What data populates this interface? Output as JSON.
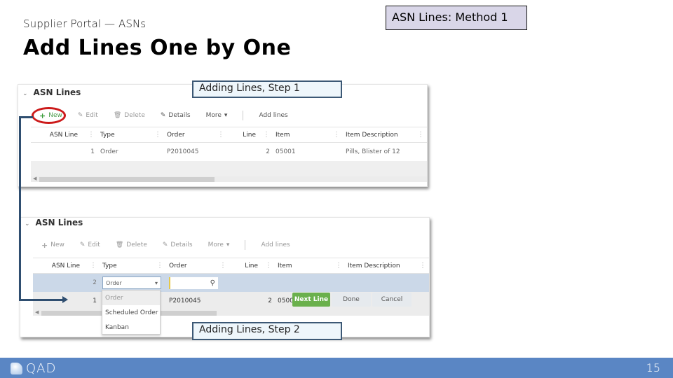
{
  "header": {
    "subtitle": "Supplier Portal — ASNs",
    "title": "Add Lines One by One",
    "method_label": "ASN Lines: Method 1"
  },
  "callouts": {
    "step1": "Adding Lines, Step 1",
    "step2": "Adding Lines, Step 2"
  },
  "panel1": {
    "heading": "ASN Lines",
    "toolbar": {
      "new": "New",
      "edit": "Edit",
      "delete": "Delete",
      "details": "Details",
      "more": "More",
      "add_lines": "Add lines"
    },
    "columns": [
      "ASN Line",
      "Type",
      "Order",
      "Line",
      "Item",
      "Item Description"
    ],
    "rows": [
      {
        "asn_line": "1",
        "type": "Order",
        "order": "P2010045",
        "line": "2",
        "item": "05001",
        "description": "Pills, Blister of 12"
      }
    ]
  },
  "panel2": {
    "heading": "ASN Lines",
    "toolbar": {
      "new": "New",
      "edit": "Edit",
      "delete": "Delete",
      "details": "Details",
      "more": "More",
      "add_lines": "Add lines"
    },
    "columns": [
      "ASN Line",
      "Type",
      "Order",
      "Line",
      "Item",
      "Item Description"
    ],
    "edit_row": {
      "asn_line": "2",
      "type_value": "Order",
      "order_value": ""
    },
    "type_options": [
      "Order",
      "Scheduled Order",
      "Kanban"
    ],
    "rows": [
      {
        "asn_line": "1",
        "order": "P2010045",
        "line": "2",
        "item": "05001"
      }
    ],
    "actions": {
      "next_line": "Next Line",
      "done": "Done",
      "cancel": "Cancel"
    }
  },
  "footer": {
    "logo_text": "QAD",
    "page_number": "15"
  },
  "colors": {
    "footer_bg": "#5a86c4",
    "method_box_bg": "#d9d6e8",
    "highlight_oval": "#cc1a1a",
    "connector": "#2f4e70",
    "next_line_button": "#6ab04c",
    "edit_row_bg": "#cbd8e8"
  }
}
